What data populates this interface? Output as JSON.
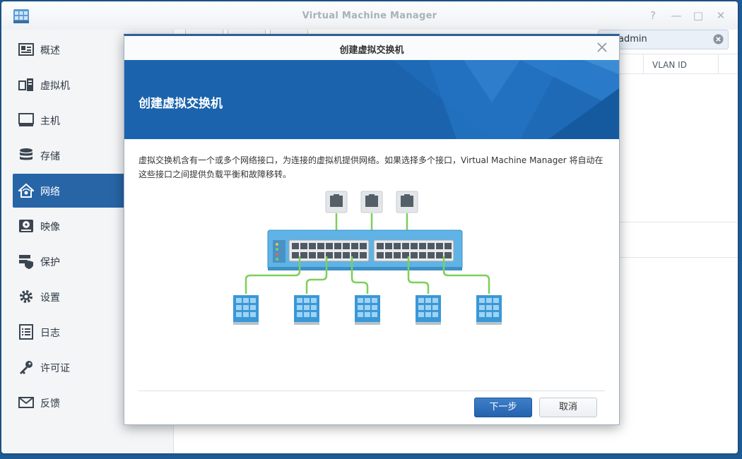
{
  "app": {
    "title": "Virtual Machine Manager"
  },
  "sidebar": {
    "items": [
      {
        "label": "概述",
        "icon": "overview-icon"
      },
      {
        "label": "虚拟机",
        "icon": "virtual-machine-icon"
      },
      {
        "label": "主机",
        "icon": "host-monitor-icon"
      },
      {
        "label": "存储",
        "icon": "storage-database-icon"
      },
      {
        "label": "网络",
        "icon": "network-home-icon",
        "active": true
      },
      {
        "label": "映像",
        "icon": "image-disk-icon"
      },
      {
        "label": "保护",
        "icon": "protection-shield-icon"
      },
      {
        "label": "设置",
        "icon": "settings-gear-icon"
      },
      {
        "label": "日志",
        "icon": "log-list-icon"
      },
      {
        "label": "许可证",
        "icon": "license-key-icon"
      },
      {
        "label": "反馈",
        "icon": "feedback-mail-icon"
      }
    ]
  },
  "main": {
    "search_value": "admin",
    "column_header": "VLAN ID"
  },
  "dialog": {
    "title": "创建虚拟交换机",
    "banner_title": "创建虚拟交换机",
    "description": "虚拟交换机含有一个或多个网络接口，为连接的虚拟机提供网络。如果选择多个接口，Virtual Machine Manager 将自动在这些接口之间提供负载平衡和故障移转。",
    "next_label": "下一步",
    "cancel_label": "取消"
  },
  "colors": {
    "accent": "#2865a7",
    "banner": "#1b63ad",
    "link_green": "#7dcf5a"
  }
}
